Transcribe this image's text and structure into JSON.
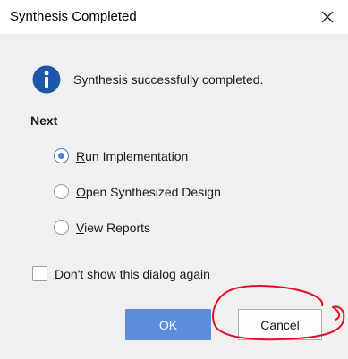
{
  "window": {
    "title": "Synthesis Completed",
    "close_icon": "close-icon"
  },
  "message": {
    "icon": "info-icon",
    "text": "Synthesis successfully completed."
  },
  "next": {
    "heading": "Next",
    "options": [
      {
        "label": "Run Implementation",
        "mnemonic": "R",
        "rest": "un Implementation",
        "selected": true
      },
      {
        "label": "Open Synthesized Design",
        "mnemonic": "O",
        "rest": "pen Synthesized Design",
        "selected": false
      },
      {
        "label": "View Reports",
        "mnemonic": "V",
        "rest": "iew Reports",
        "selected": false
      }
    ]
  },
  "dont_show": {
    "label": "Don't show this dialog again",
    "mnemonic": "D",
    "rest": "on't show this dialog again",
    "checked": false
  },
  "buttons": {
    "ok_label": "OK",
    "cancel_label": "Cancel"
  },
  "colors": {
    "accent": "#5b8ddb",
    "info_icon": "#1f57a8",
    "annotation": "#e3102b"
  }
}
